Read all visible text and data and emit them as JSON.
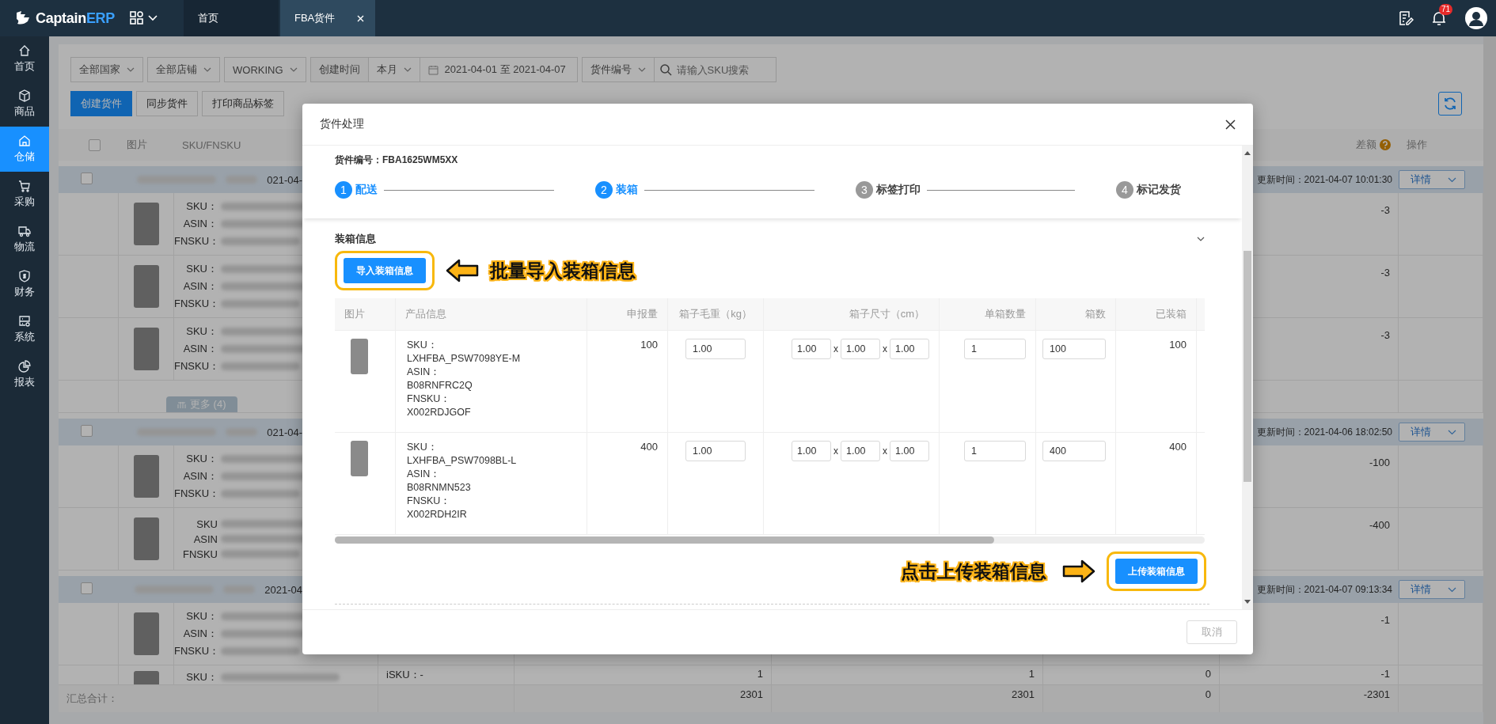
{
  "topbar": {
    "logo_text": "Captain",
    "logo_accent": "ERP",
    "tabs": [
      {
        "label": "首页",
        "selected": false,
        "closable": false
      },
      {
        "label": "FBA货件",
        "selected": true,
        "closable": true
      }
    ],
    "notification_count": "71"
  },
  "sidebar": {
    "items": [
      {
        "label": "首页",
        "selected": false
      },
      {
        "label": "商品",
        "selected": false
      },
      {
        "label": "仓储",
        "selected": true
      },
      {
        "label": "采购",
        "selected": false
      },
      {
        "label": "物流",
        "selected": false
      },
      {
        "label": "财务",
        "selected": false
      },
      {
        "label": "系统",
        "selected": false
      },
      {
        "label": "报表",
        "selected": false
      }
    ]
  },
  "filters": [
    {
      "kind": "select",
      "label": "全部国家"
    },
    {
      "kind": "select",
      "label": "全部店铺"
    },
    {
      "kind": "select",
      "label": "WORKING"
    },
    {
      "kind": "label",
      "label": "创建时间"
    },
    {
      "kind": "select",
      "label": "本月"
    },
    {
      "kind": "date",
      "label": "2021-04-01 至 2021-04-07"
    },
    {
      "kind": "select",
      "label": "货件编号"
    },
    {
      "kind": "search",
      "placeholder": "请输入SKU搜索"
    }
  ],
  "actions": [
    {
      "label": "创建货件",
      "primary": true
    },
    {
      "label": "同步货件",
      "primary": false
    },
    {
      "label": "打印商品标签",
      "primary": false
    }
  ],
  "table": {
    "header": {
      "checked": false,
      "image": "图片",
      "sku": "SKU/FNSKU",
      "diff": "差额",
      "ops": "操作"
    },
    "groups": [
      {
        "checked": false,
        "date_fragment": "021-04-",
        "updated": "更新时间：2021-04-07 10:01:30",
        "action": "详情",
        "more": "更多 (4)",
        "items": [
          {
            "labels": [
              "SKU：",
              "ASIN：",
              "FNSKU："
            ],
            "diff": "-3"
          },
          {
            "labels": [
              "SKU：",
              "ASIN：",
              "FNSKU："
            ],
            "diff": "-3"
          },
          {
            "labels": [
              "SKU：",
              "ASIN：",
              "FNSKU："
            ],
            "diff": "-3"
          }
        ]
      },
      {
        "checked": false,
        "date_fragment": "021-04-",
        "updated": "更新时间：2021-04-06 18:02:50",
        "action": "详情",
        "items": [
          {
            "labels": [
              "SKU：",
              "ASIN：",
              "FNSKU："
            ],
            "diff": "-100"
          },
          {
            "labels": [
              "SKU",
              "ASIN",
              "FNSKU"
            ],
            "diff": "-400"
          }
        ]
      },
      {
        "checked": false,
        "date_fragment": "2021-04",
        "updated": "更新时间：2021-04-07 09:13:34",
        "action": "详情",
        "items": [
          {
            "labels": [
              "SKU：",
              "ASIN：",
              "FNSKU："
            ],
            "diff": "-1"
          }
        ]
      }
    ],
    "partial_row": {
      "label": "SKU：",
      "isku": "iSKU：-",
      "values": [
        "1",
        "1",
        "0",
        "-1"
      ]
    },
    "summary": {
      "label": "汇总合计：",
      "values": [
        "2301",
        "2301",
        "0",
        "-2301"
      ]
    }
  },
  "modal": {
    "title": "货件处理",
    "shipment": "货件编号：FBA1625WM5XX",
    "steps": [
      {
        "number": "1",
        "label": "配送",
        "active": true
      },
      {
        "number": "2",
        "label": "装箱",
        "active": true
      },
      {
        "number": "3",
        "label": "标签打印",
        "active": false
      },
      {
        "number": "4",
        "label": "标记发货",
        "active": false
      }
    ],
    "section_title": "装箱信息",
    "import_button": "导入装箱信息",
    "import_hint": "批量导入装箱信息",
    "columns": [
      "图片",
      "产品信息",
      "申报量",
      "箱子毛重（kg）",
      "箱子尺寸（cm）",
      "单箱数量",
      "箱数",
      "已装箱"
    ],
    "rows": [
      {
        "info": [
          "SKU：",
          "LXHFBA_PSW7098YE-M",
          "ASIN：",
          "B08RNFRC2Q",
          "FNSKU：",
          "X002RDJGOF"
        ],
        "declared": "100",
        "weight": "1.00",
        "dims": [
          "1.00",
          "1.00",
          "1.00"
        ],
        "separators": [
          "x",
          "x"
        ],
        "per_box": "1",
        "boxes": "100",
        "packed": "100"
      },
      {
        "info": [
          "SKU：",
          "LXHFBA_PSW7098BL-L",
          "ASIN：",
          "B08RNMN523",
          "FNSKU：",
          "X002RDH2IR"
        ],
        "declared": "400",
        "weight": "1.00",
        "dims": [
          "1.00",
          "1.00",
          "1.00"
        ],
        "separators": [
          "x",
          "x"
        ],
        "per_box": "1",
        "boxes": "400",
        "packed": "400"
      }
    ],
    "upload_hint": "点击上传装箱信息",
    "upload_button": "上传装箱信息",
    "cancel": "取消"
  }
}
